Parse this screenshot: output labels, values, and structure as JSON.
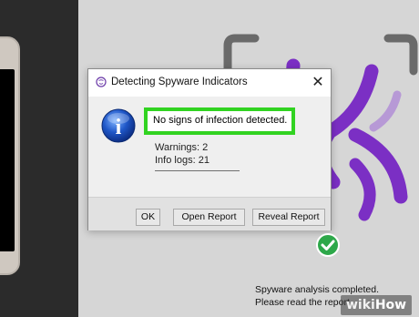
{
  "dialog": {
    "title": "Detecting Spyware Indicators",
    "close_glyph": "✕",
    "message": "No signs of infection detected.",
    "warnings_text": "Warnings: 2",
    "info_logs_text": "Info logs: 21",
    "buttons": {
      "ok": "OK",
      "open_report": "Open Report",
      "reveal_report": "Reveal Report"
    },
    "icons": {
      "title": "app-logo-icon",
      "info": "info-icon"
    },
    "highlight_color": "#31d321"
  },
  "status": {
    "line1": "Spyware analysis completed.",
    "line2": "Please read the report"
  },
  "watermark": {
    "wiki": "wiki",
    "how": "How"
  },
  "colors": {
    "accent_purple": "#7b2fc4",
    "check_green": "#2ea84a",
    "background_dark": "#2b2b2b",
    "background_app": "#d6d6d6"
  }
}
